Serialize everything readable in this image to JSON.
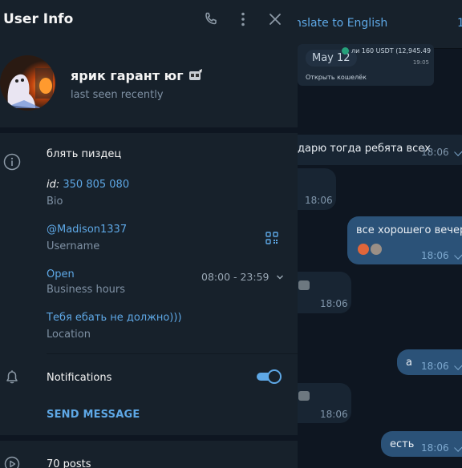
{
  "panel": {
    "title": "User Info",
    "profile": {
      "name": "ярик гарант юг",
      "status": "last seen recently"
    },
    "info": {
      "bio_text": "блять пиздец",
      "id_prefix": "id:",
      "id_value": "350 805 080",
      "bio_label": "Bio",
      "username_value": "@Madison1337",
      "username_label": "Username",
      "hours_status": "Open",
      "hours_range": "08:00 - 23:59",
      "hours_label": "Business hours",
      "location_value": "Тебя ебать не должно)))",
      "location_label": "Location"
    },
    "notifications": {
      "label": "Notifications",
      "enabled": true
    },
    "send_message": "SEND MESSAGE",
    "posts": "70 posts"
  },
  "chat": {
    "translate": "nslate to English",
    "translate_edge": "1",
    "pinned": {
      "date": "May 12",
      "amount": "ли  160 USDT (12,945.49",
      "time": "19:05",
      "action": "Открыть кошелёк"
    },
    "messages": [
      {
        "text": "дарю тогда ребята всех",
        "time": "18:06"
      },
      {
        "text": "",
        "time": "18:06"
      },
      {
        "text": "все хорошего вечера",
        "time": "18:06"
      },
      {
        "text": "",
        "time": "18:06"
      },
      {
        "text": "а",
        "time": "18:06"
      },
      {
        "text": "",
        "time": "18:06"
      },
      {
        "text": "есть",
        "time": "18:06"
      }
    ]
  },
  "colors": {
    "accent": "#5ea8e6",
    "panel_bg": "#17212b",
    "chat_bg": "#0e1621",
    "outgoing_bubble": "#2b5278",
    "incoming_bubble": "#182533"
  }
}
